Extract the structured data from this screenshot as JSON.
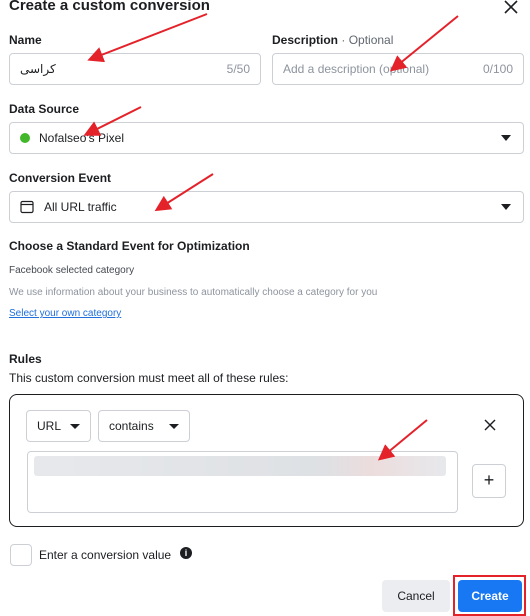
{
  "dialog": {
    "title": "Create a custom conversion"
  },
  "name_field": {
    "label": "Name",
    "value": "کراسی",
    "counter": "5/50"
  },
  "description_field": {
    "label": "Description",
    "optional": "· Optional",
    "placeholder": "Add a description (optional)",
    "counter": "0/100"
  },
  "data_source": {
    "label": "Data Source",
    "value": "Nofalseo's Pixel",
    "status_color": "#42b72a"
  },
  "conversion_event": {
    "label": "Conversion Event",
    "value": "All URL traffic",
    "icon": "calendar-icon"
  },
  "standard_event": {
    "heading": "Choose a Standard Event for Optimization",
    "selected_category": "Facebook selected category",
    "info": "We use information about your business to automatically choose a category for you",
    "link": "Select your own category"
  },
  "rules": {
    "heading": "Rules",
    "subheading": "This custom conversion must meet all of these rules:",
    "field_select": "URL",
    "operator_select": "contains",
    "add_label": "+"
  },
  "conversion_value": {
    "label": "Enter a conversion value",
    "checked": false
  },
  "footer": {
    "cancel_label": "Cancel",
    "create_label": "Create"
  },
  "colors": {
    "primary": "#1877f2",
    "annotation": "#e4222a",
    "link": "#216fdb"
  }
}
